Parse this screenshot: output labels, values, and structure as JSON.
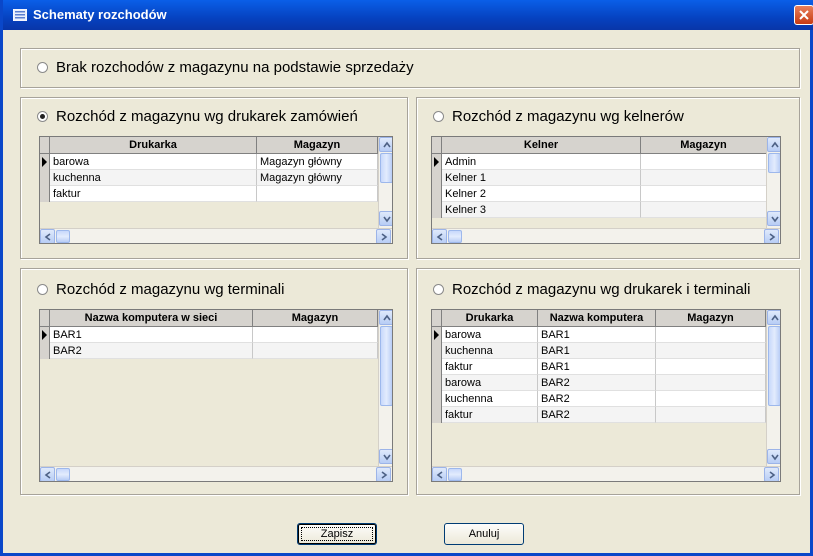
{
  "window": {
    "title": "Schematy rozchodów"
  },
  "options": {
    "none": {
      "label": "Brak rozchodów z magazynu na podstawie sprzedaży",
      "selected": false
    },
    "printers": {
      "label": "Rozchód z magazynu wg drukarek zamówień",
      "selected": true
    },
    "waiters": {
      "label": "Rozchód z magazynu wg kelnerów",
      "selected": false
    },
    "terminals": {
      "label": "Rozchód z magazynu wg terminali",
      "selected": false
    },
    "printers_terminals": {
      "label": "Rozchód z magazynu wg drukarek i terminali",
      "selected": false
    }
  },
  "grids": {
    "printers": {
      "columns": [
        "Drukarka",
        "Magazyn"
      ],
      "rows": [
        [
          "barowa",
          "Magazyn główny"
        ],
        [
          "kuchenna",
          "Magazyn główny"
        ],
        [
          "faktur",
          ""
        ]
      ]
    },
    "waiters": {
      "columns": [
        "Kelner",
        "Magazyn"
      ],
      "rows": [
        [
          "Admin",
          ""
        ],
        [
          "Kelner 1",
          ""
        ],
        [
          "Kelner 2",
          ""
        ],
        [
          "Kelner 3",
          ""
        ]
      ]
    },
    "terminals": {
      "columns": [
        "Nazwa komputera w sieci",
        "Magazyn"
      ],
      "rows": [
        [
          "BAR1",
          ""
        ],
        [
          "BAR2",
          ""
        ]
      ]
    },
    "printers_terminals": {
      "columns": [
        "Drukarka",
        "Nazwa komputera",
        "Magazyn"
      ],
      "rows": [
        [
          "barowa",
          "BAR1",
          ""
        ],
        [
          "kuchenna",
          "BAR1",
          ""
        ],
        [
          "faktur",
          "BAR1",
          ""
        ],
        [
          "barowa",
          "BAR2",
          ""
        ],
        [
          "kuchenna",
          "BAR2",
          ""
        ],
        [
          "faktur",
          "BAR2",
          ""
        ]
      ]
    }
  },
  "buttons": {
    "save": "Zapisz",
    "cancel": "Anuluj"
  },
  "icons": {
    "window": "list-window-icon",
    "close": "close-icon"
  },
  "colors": {
    "titlebar": "#0642c0",
    "close": "#c73a12",
    "face": "#ece9d8"
  }
}
